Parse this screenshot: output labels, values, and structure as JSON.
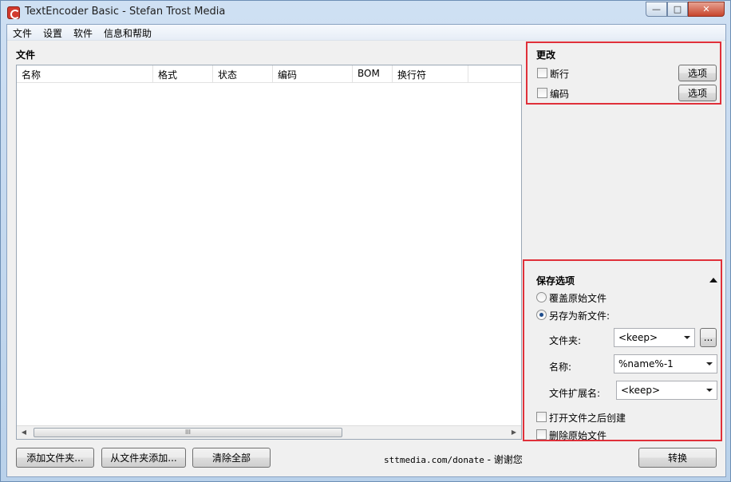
{
  "window": {
    "title": "TextEncoder Basic - Stefan Trost Media",
    "controls": {
      "minimize": "—",
      "maximize": "□",
      "close": "✕"
    }
  },
  "menu": [
    "文件",
    "设置",
    "软件",
    "信息和帮助"
  ],
  "files": {
    "title": "文件",
    "columns": [
      "名称",
      "格式",
      "状态",
      "编码",
      "BOM",
      "换行符"
    ],
    "rows": [],
    "scroll_thumb": "III"
  },
  "change": {
    "title": "更改",
    "linebreak": {
      "label": "断行",
      "checked": false,
      "button": "选项"
    },
    "encoding": {
      "label": "编码",
      "checked": false,
      "button": "选项"
    }
  },
  "save": {
    "title": "保存选项",
    "overwrite_label": "覆盖原始文件",
    "save_as_new_label": "另存为新文件:",
    "selected": "save_as_new",
    "folder_label": "文件夹:",
    "folder_value": "<keep>",
    "browse_button": "...",
    "name_label": "名称:",
    "name_value": "%name%-1",
    "extension_label": "文件扩展名:",
    "extension_value": "<keep>",
    "open_after_create_label": "打开文件之后创建",
    "delete_original_label": "删除原始文件"
  },
  "bottom": {
    "add_folder_button": "添加文件夹...",
    "add_from_folder_button": "从文件夹添加...",
    "clear_all_button": "清除全部",
    "donate_url": "sttmedia.com/donate",
    "donate_thanks": " - 谢谢您",
    "convert_button": "转换"
  }
}
